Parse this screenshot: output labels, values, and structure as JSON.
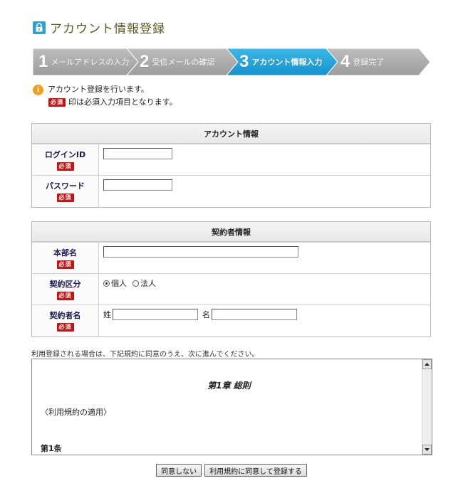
{
  "page_title": "アカウント情報登録",
  "steps": [
    {
      "num": "1",
      "label": "メールアドレスの入力",
      "active": false
    },
    {
      "num": "2",
      "label": "受信メールの確認",
      "active": false
    },
    {
      "num": "3",
      "label": "アカウント情報入力",
      "active": true
    },
    {
      "num": "4",
      "label": "登録完了",
      "active": false
    }
  ],
  "notice": {
    "info_icon_text": "i",
    "line1": "アカウント登録を行います。",
    "required_badge": "必須",
    "line2": "印は必須入力項目となります。"
  },
  "account_panel": {
    "title": "アカウント情報",
    "rows": [
      {
        "label": "ログインID",
        "badge": "必須",
        "value": ""
      },
      {
        "label": "パスワード",
        "badge": "必須",
        "value": ""
      }
    ]
  },
  "contract_panel": {
    "title": "契約者情報",
    "department": {
      "label": "本部名",
      "badge": "必須",
      "value": ""
    },
    "contract_type": {
      "label": "契約区分",
      "badge": "必須",
      "options": [
        "個人",
        "法人"
      ],
      "selected": "個人"
    },
    "contractor_name": {
      "label": "契約者名",
      "badge": "必須",
      "sei_label": "姓",
      "mei_label": "名",
      "sei_value": "",
      "mei_value": ""
    }
  },
  "terms": {
    "intro": "利用登録される場合は、下記規約に同意のうえ、次に進んでください。",
    "chapter": "第1章 総則",
    "section_heading": "〈利用規約の適用〉",
    "article": "第1条"
  },
  "buttons": {
    "disagree": "同意しない",
    "agree": "利用規約に同意して登録する"
  },
  "colors": {
    "step_inactive": "#a6a6a6",
    "step_active": "#1aa3dc",
    "required_badge": "#cc1111",
    "title_text": "#5a5a1e"
  }
}
